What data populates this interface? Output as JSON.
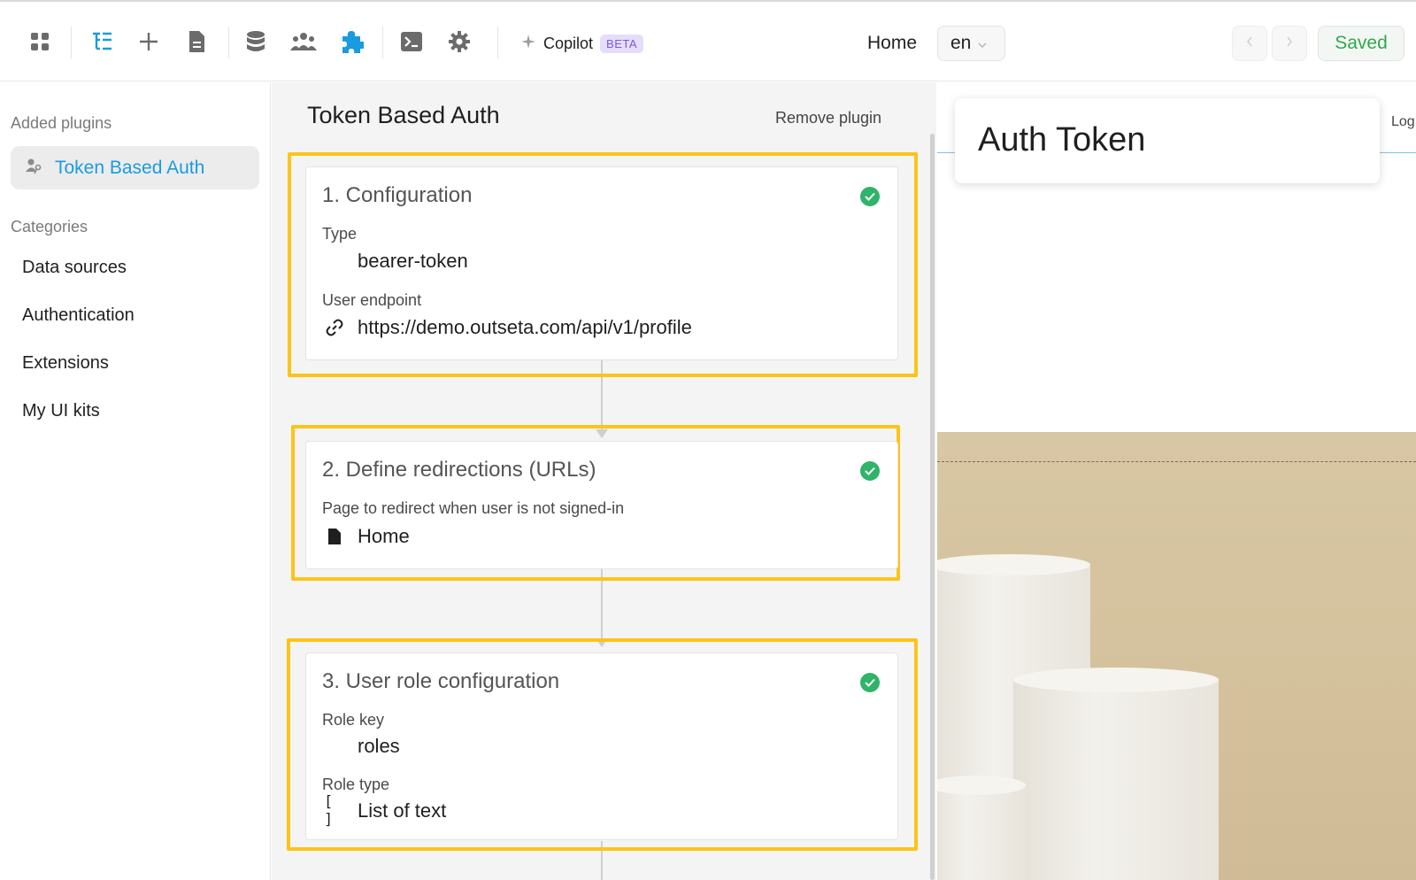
{
  "toolbar": {
    "copilot_label": "Copilot",
    "beta_badge": "BETA",
    "page_name": "Home",
    "language": "en",
    "saved_label": "Saved",
    "icons": [
      "apps-grid-icon",
      "layers-tree-icon",
      "plus-icon",
      "page-icon",
      "database-icon",
      "users-icon",
      "puzzle-plugin-icon",
      "terminal-icon",
      "gear-icon",
      "sparkle-icon"
    ],
    "accent_color": "#1a9be0",
    "saved_color": "#2fa84f"
  },
  "sidebar": {
    "added_heading": "Added plugins",
    "active_plugin": "Token Based Auth",
    "categories_heading": "Categories",
    "categories": [
      "Data sources",
      "Authentication",
      "Extensions",
      "My UI kits"
    ]
  },
  "panel": {
    "title": "Token Based Auth",
    "remove_label": "Remove plugin",
    "highlight_color": "#fcc419",
    "steps": [
      {
        "title": "1. Configuration",
        "fields": [
          {
            "label": "Type",
            "value": "bearer-token"
          },
          {
            "label": "User endpoint",
            "value": "https://demo.outseta.com/api/v1/profile"
          }
        ]
      },
      {
        "title": "2. Define redirections (URLs)",
        "fields": [
          {
            "label": "Page to redirect when user is not signed-in",
            "value": "Home"
          }
        ]
      },
      {
        "title": "3. User role configuration",
        "fields": [
          {
            "label": "Role key",
            "value": "roles"
          },
          {
            "label": "Role type",
            "value": "List of text",
            "icon_glyph": "[ ]"
          }
        ]
      }
    ]
  },
  "preview": {
    "popup_title": "Auth Token",
    "partial_label": "Log"
  }
}
